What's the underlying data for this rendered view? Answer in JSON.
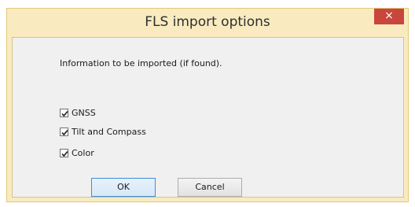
{
  "window": {
    "title": "FLS import options",
    "close_glyph": "×",
    "close_icon": "close-icon"
  },
  "content": {
    "info_text": "Information to be imported (if found).",
    "options": [
      {
        "label": "GNSS",
        "checked": true
      },
      {
        "label": "Tilt and Compass",
        "checked": true
      },
      {
        "label": "Color",
        "checked": true
      }
    ]
  },
  "buttons": {
    "ok_label": "OK",
    "cancel_label": "Cancel"
  },
  "colors": {
    "title_bar": "#f9ebbf",
    "close_button": "#c9463d",
    "dialog_background": "#f0f0f0",
    "default_button_border": "#3c8fd8"
  }
}
